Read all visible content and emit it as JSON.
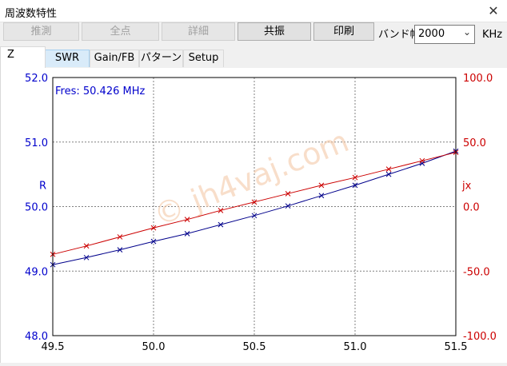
{
  "window": {
    "title": "周波数特性",
    "close_glyph": "✕"
  },
  "toolbar": {
    "buttons": [
      {
        "label": "推測",
        "enabled": false
      },
      {
        "label": "全点",
        "enabled": false
      },
      {
        "label": "詳細",
        "enabled": false
      },
      {
        "label": "共振",
        "enabled": true
      },
      {
        "label": "印刷",
        "enabled": true
      }
    ],
    "bandwidth_label": "バンド幅",
    "bandwidth_value": "2000",
    "bandwidth_unit": "KHz"
  },
  "tabs": [
    {
      "label": "Z",
      "active": true
    },
    {
      "label": "SWR",
      "active": false
    },
    {
      "label": "Gain/FB",
      "active": false
    },
    {
      "label": "パターン",
      "active": false
    },
    {
      "label": "Setup",
      "active": false
    }
  ],
  "watermark": "© jh4vaj.com",
  "chart_data": {
    "type": "line",
    "annotation": "Fres: 50.426 MHz",
    "xlim": [
      49.5,
      51.5
    ],
    "x_ticks": [
      "49.5",
      "50.0",
      "50.5",
      "51.0",
      "51.5"
    ],
    "left_axis": {
      "label": "R",
      "ylim": [
        48.0,
        52.0
      ],
      "ticks": [
        "52.0",
        "51.0",
        "50.0",
        "49.0",
        "48.0"
      ],
      "color": "#0000cc"
    },
    "right_axis": {
      "label": "jx",
      "ylim": [
        -100.0,
        100.0
      ],
      "ticks": [
        "100.0",
        "50.0",
        "0.0",
        "-50.0",
        "-100.0"
      ],
      "color": "#cc0000"
    },
    "grid": true,
    "series": [
      {
        "axis": "left",
        "color": "#00008b",
        "x": [
          49.5,
          49.667,
          49.833,
          50.0,
          50.167,
          50.333,
          50.5,
          50.667,
          50.833,
          51.0,
          51.167,
          51.333,
          51.5
        ],
        "y": [
          49.1,
          49.21,
          49.33,
          49.46,
          49.58,
          49.72,
          49.86,
          50.01,
          50.17,
          50.33,
          50.5,
          50.67,
          50.86
        ]
      },
      {
        "axis": "right",
        "color": "#cc0000",
        "x": [
          49.5,
          49.667,
          49.833,
          50.0,
          50.167,
          50.333,
          50.5,
          50.667,
          50.833,
          51.0,
          51.167,
          51.333,
          51.5
        ],
        "y": [
          -37.0,
          -30.5,
          -23.5,
          -16.5,
          -10.0,
          -3.0,
          3.5,
          10.0,
          16.5,
          22.5,
          29.0,
          35.5,
          42.0
        ]
      }
    ]
  }
}
